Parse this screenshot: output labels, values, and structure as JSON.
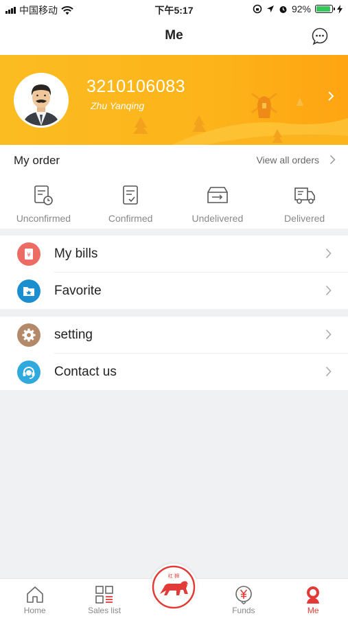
{
  "status_bar": {
    "carrier": "中国移动",
    "time": "下午5:17",
    "battery": "92%",
    "battery_level": 0.92
  },
  "header": {
    "title": "Me"
  },
  "profile": {
    "account_number": "3210106083",
    "username": "Zhu Yanqing"
  },
  "orders": {
    "title": "My order",
    "view_all": "View all orders",
    "statuses": [
      {
        "label": "Unconfirmed",
        "icon": "clipboard-clock-icon"
      },
      {
        "label": "Confirmed",
        "icon": "clipboard-check-icon"
      },
      {
        "label": "Undelivered",
        "icon": "box-arrow-icon"
      },
      {
        "label": "Delivered",
        "icon": "truck-icon"
      }
    ]
  },
  "menu": {
    "group1": [
      {
        "label": "My bills",
        "icon": "bill-icon",
        "color": "#ec6b63"
      },
      {
        "label": "Favorite",
        "icon": "folder-star-icon",
        "color": "#1b8ecf"
      }
    ],
    "group2": [
      {
        "label": "setting",
        "icon": "gear-icon",
        "color": "#b4896a"
      },
      {
        "label": "Contact us",
        "icon": "headset-icon",
        "color": "#30a9de"
      }
    ]
  },
  "tabs": [
    {
      "label": "Home",
      "icon": "home-icon",
      "active": false
    },
    {
      "label": "Sales list",
      "icon": "grid-list-icon",
      "active": false
    },
    {
      "label": "",
      "icon": "lion-logo-icon",
      "active": false
    },
    {
      "label": "Funds",
      "icon": "yen-icon",
      "active": false
    },
    {
      "label": "Me",
      "icon": "person-icon",
      "active": true
    }
  ],
  "logo_text": "红 狮",
  "colors": {
    "accent": "#e23a36",
    "banner": "#fbbc22",
    "battery": "#34c759"
  }
}
